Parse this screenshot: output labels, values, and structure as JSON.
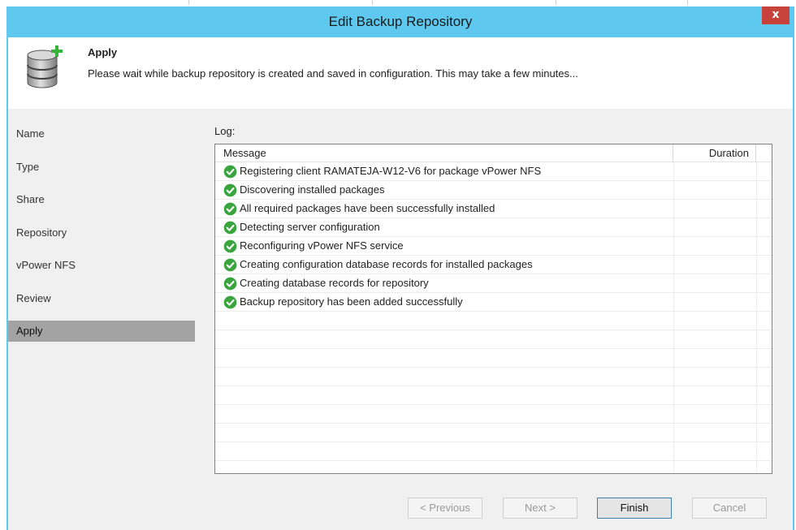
{
  "window": {
    "title": "Edit Backup Repository",
    "close_glyph": "x"
  },
  "header": {
    "icon": "database-add-icon",
    "step_title": "Apply",
    "description": "Please wait while backup repository is created and saved in configuration. This may take a few minutes..."
  },
  "sidebar": {
    "items": [
      {
        "label": "Name"
      },
      {
        "label": "Type"
      },
      {
        "label": "Share"
      },
      {
        "label": "Repository"
      },
      {
        "label": "vPower NFS"
      },
      {
        "label": "Review"
      },
      {
        "label": "Apply",
        "active": true
      }
    ]
  },
  "log": {
    "label": "Log:",
    "columns": {
      "message": "Message",
      "duration": "Duration"
    },
    "rows": [
      {
        "status": "success",
        "message": "Registering client RAMATEJA-W12-V6 for package vPower NFS",
        "duration": ""
      },
      {
        "status": "success",
        "message": "Discovering installed packages",
        "duration": ""
      },
      {
        "status": "success",
        "message": "All required packages have been successfully installed",
        "duration": ""
      },
      {
        "status": "success",
        "message": "Detecting server configuration",
        "duration": ""
      },
      {
        "status": "success",
        "message": "Reconfiguring vPower NFS service",
        "duration": ""
      },
      {
        "status": "success",
        "message": "Creating configuration database records for installed packages",
        "duration": ""
      },
      {
        "status": "success",
        "message": "Creating database records for repository",
        "duration": ""
      },
      {
        "status": "success",
        "message": "Backup repository has been added successfully",
        "duration": ""
      }
    ]
  },
  "buttons": {
    "previous": "< Previous",
    "next": "Next >",
    "finish": "Finish",
    "cancel": "Cancel"
  },
  "colors": {
    "titlebar": "#5ec8ee",
    "close": "#c7423a",
    "success": "#3aa53e",
    "active_nav": "#a3a3a3"
  }
}
